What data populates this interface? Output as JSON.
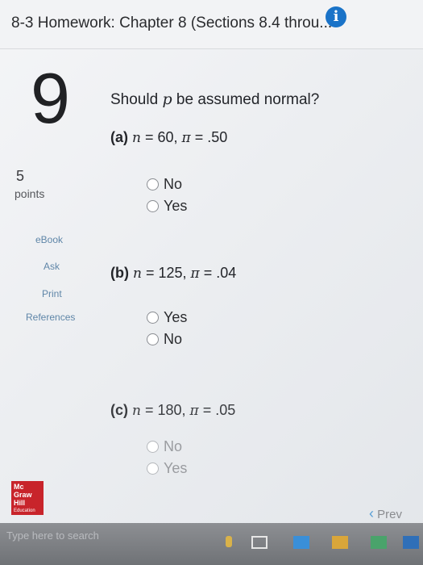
{
  "header": {
    "title": "8-3 Homework: Chapter 8 (Sections 8.4 throu...",
    "info_label": "i"
  },
  "question": {
    "number": "9",
    "points_value": "5",
    "points_label": "points",
    "prompt_pre": "Should ",
    "prompt_var": "p",
    "prompt_post": " be assumed normal?"
  },
  "sidebar": {
    "ebook": "eBook",
    "ask": "Ask",
    "print": "Print",
    "references": "References"
  },
  "parts": [
    {
      "label": "(a)",
      "n_var": "n",
      "n_text": " = 60, ",
      "pi_var": "π",
      "pi_text": " = .50",
      "options": [
        "No",
        "Yes"
      ]
    },
    {
      "label": "(b)",
      "n_var": "n",
      "n_text": " = 125, ",
      "pi_var": "π",
      "pi_text": " = .04",
      "options": [
        "Yes",
        "No"
      ]
    },
    {
      "label": "(c)",
      "n_var": "n",
      "n_text": " = 180, ",
      "pi_var": "π",
      "pi_text": " = .05",
      "options": [
        "No",
        "Yes"
      ]
    }
  ],
  "logo": {
    "line1": "Mc",
    "line2": "Graw",
    "line3": "Hill",
    "line4": "Education"
  },
  "nav": {
    "prev_label": "Prev",
    "prev_arrow": "‹"
  },
  "taskbar": {
    "search_placeholder": "Type here to search"
  },
  "colors": {
    "accent": "#1a73c8",
    "logo": "#c8242b"
  }
}
